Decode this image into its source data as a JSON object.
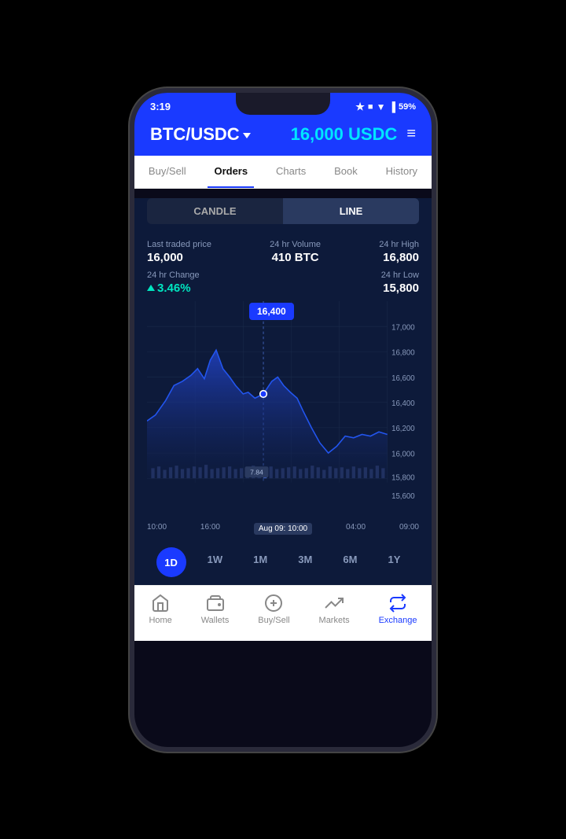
{
  "phone": {
    "status_bar": {
      "time": "3:19",
      "battery": "59%"
    },
    "header": {
      "pair": "BTC/USDC",
      "price": "16,000 USDC",
      "menu_label": "≡"
    },
    "nav_tabs": [
      {
        "label": "Buy/Sell",
        "active": false
      },
      {
        "label": "Orders",
        "active": false
      },
      {
        "label": "Charts",
        "active": true
      },
      {
        "label": "Book",
        "active": false
      },
      {
        "label": "History",
        "active": false
      }
    ],
    "chart_toggle": {
      "candle_label": "CANDLE",
      "line_label": "LINE",
      "active": "LINE"
    },
    "stats": {
      "last_traded_label": "Last traded price",
      "last_traded_value": "16,000",
      "volume_label": "24 hr Volume",
      "volume_value": "410 BTC",
      "high_label": "24 hr High",
      "high_value": "16,800",
      "change_label": "24 hr Change",
      "change_value": "3.46%",
      "low_label": "24 hr Low",
      "low_value": "15,800"
    },
    "chart": {
      "tooltip_price": "16,400",
      "tooltip_date": "Aug 09: 10:00",
      "volume_label": "7.84",
      "time_labels": [
        "10:00",
        "16:00",
        "Aug 09: 10:00",
        "04:00",
        "09:00"
      ],
      "y_labels": [
        "17,000",
        "16,800",
        "16,600",
        "16,400",
        "16,200",
        "16,000",
        "15,800",
        "15,600"
      ]
    },
    "periods": [
      {
        "label": "1D",
        "active": true
      },
      {
        "label": "1W",
        "active": false
      },
      {
        "label": "1M",
        "active": false
      },
      {
        "label": "3M",
        "active": false
      },
      {
        "label": "6M",
        "active": false
      },
      {
        "label": "1Y",
        "active": false
      }
    ],
    "bottom_nav": [
      {
        "label": "Home",
        "icon": "home",
        "active": false
      },
      {
        "label": "Wallets",
        "icon": "wallet",
        "active": false
      },
      {
        "label": "Buy/Sell",
        "icon": "buysell",
        "active": false
      },
      {
        "label": "Markets",
        "icon": "markets",
        "active": false
      },
      {
        "label": "Exchange",
        "icon": "exchange",
        "active": true
      }
    ]
  }
}
